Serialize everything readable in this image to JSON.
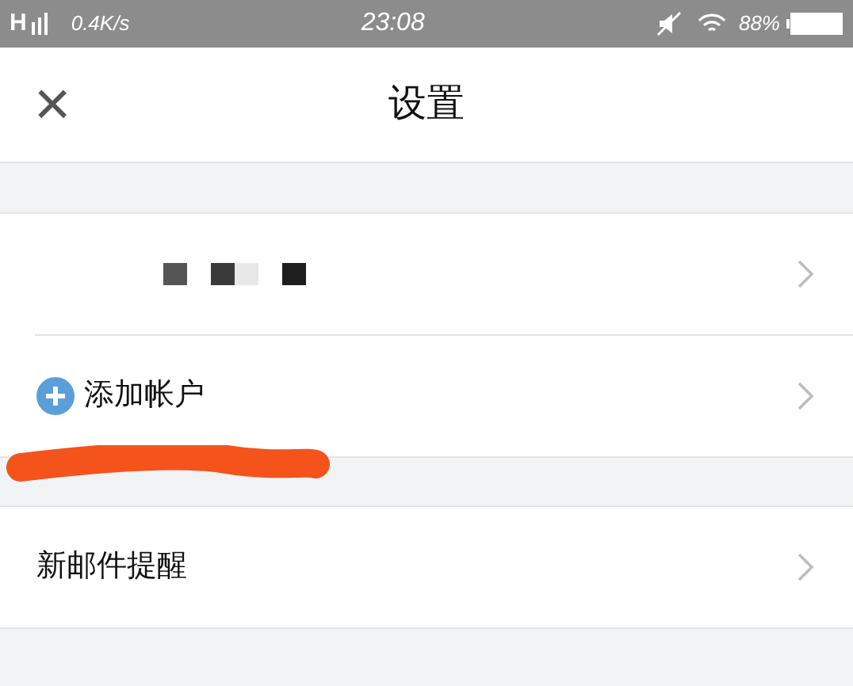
{
  "status_bar": {
    "network": "H",
    "speed": "0.4K/s",
    "time": "23:08",
    "battery": "88%"
  },
  "nav_bar": {
    "close": "×",
    "title": "设置"
  },
  "sections": [
    {
      "rows": [
        {
          "kind": "account"
        },
        {
          "kind": "add",
          "label": "添加帐户"
        }
      ]
    },
    {
      "rows": [
        {
          "kind": "plain",
          "label": "新邮件提醒"
        }
      ]
    }
  ]
}
